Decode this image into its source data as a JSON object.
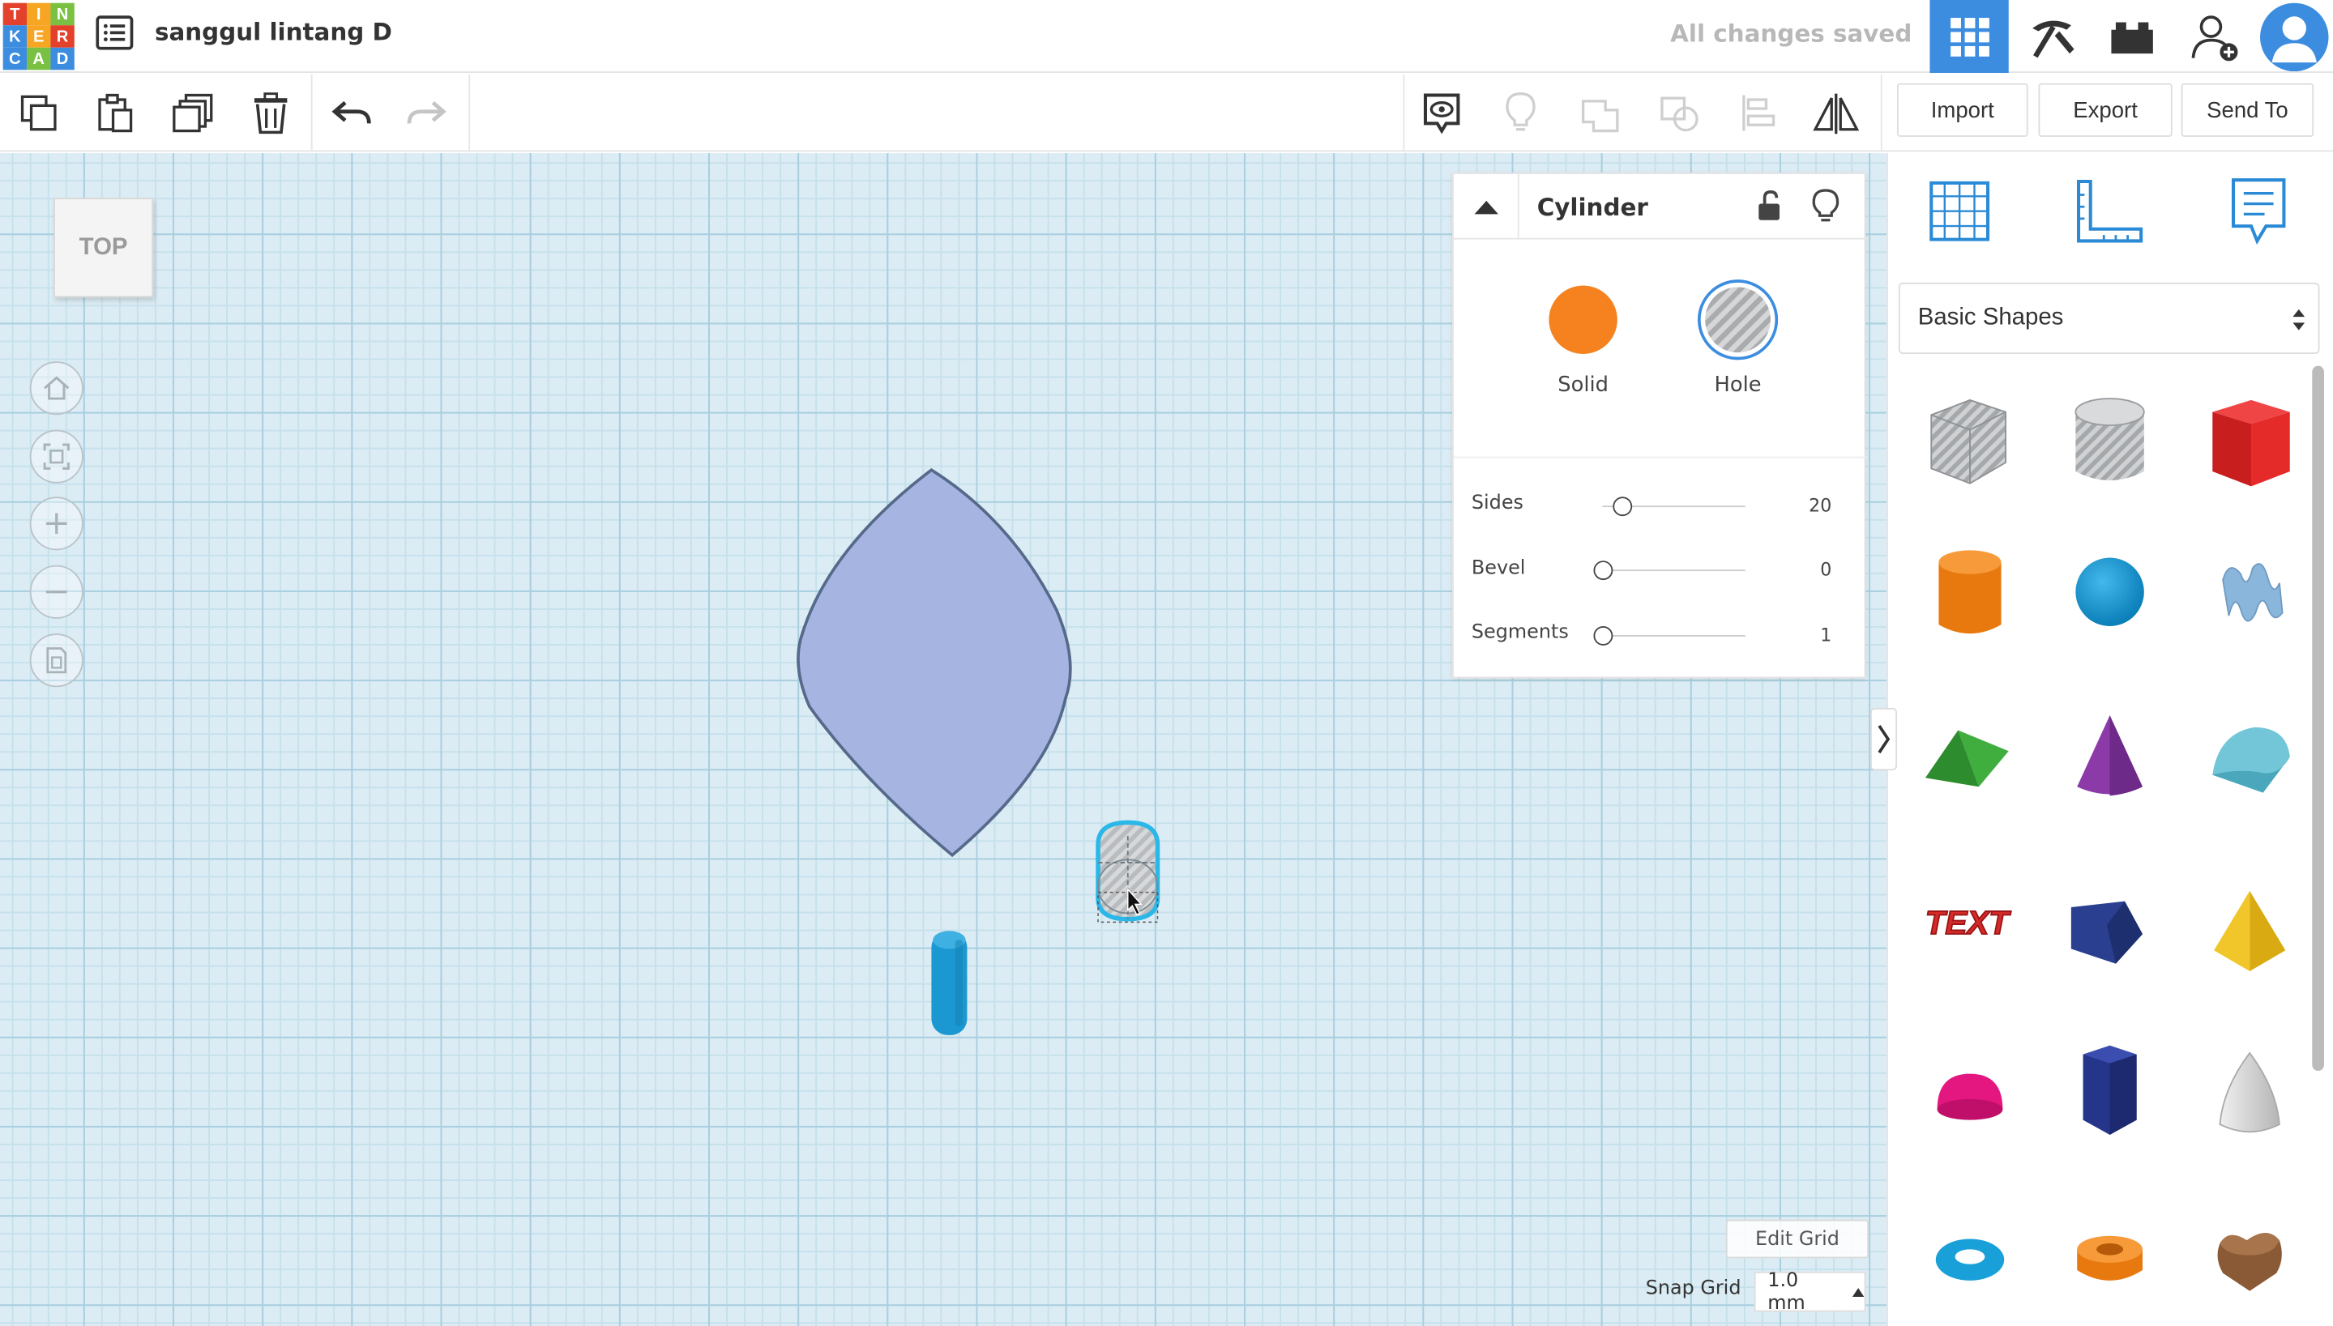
{
  "header": {
    "logo_letters": [
      "T",
      "I",
      "N",
      "K",
      "E",
      "R",
      "C",
      "A",
      "D"
    ],
    "logo_colors": [
      "#e3412b",
      "#f6a623",
      "#7ac143",
      "#3c8de0",
      "#f6a623",
      "#e3412b",
      "#3c8de0",
      "#7ac143",
      "#3c8de0"
    ],
    "doc_title": "sanggul lintang D",
    "save_status": "All changes saved",
    "accent": "#3c8de0"
  },
  "toolbar": {
    "import_label": "Import",
    "export_label": "Export",
    "send_to_label": "Send To"
  },
  "viewcube": {
    "face_label": "TOP"
  },
  "inspector": {
    "title": "Cylinder",
    "solid_label": "Solid",
    "hole_label": "Hole",
    "solid_color": "#f5821f",
    "params": [
      {
        "label": "Sides",
        "value": "20",
        "fraction": 0.14
      },
      {
        "label": "Bevel",
        "value": "0",
        "fraction": 0.0
      },
      {
        "label": "Segments",
        "value": "1",
        "fraction": 0.0
      }
    ]
  },
  "shapes_panel": {
    "category": "Basic Shapes",
    "shapes": [
      "box-hole",
      "cylinder-hole",
      "box",
      "cylinder",
      "sphere",
      "scribble",
      "roof",
      "cone",
      "round-roof",
      "text",
      "wedge",
      "pyramid",
      "half-sphere",
      "polygon",
      "paraboloid",
      "torus",
      "tube",
      "heart"
    ]
  },
  "grid": {
    "edit_label": "Edit Grid",
    "snap_label": "Snap Grid",
    "snap_value": "1.0 mm"
  }
}
